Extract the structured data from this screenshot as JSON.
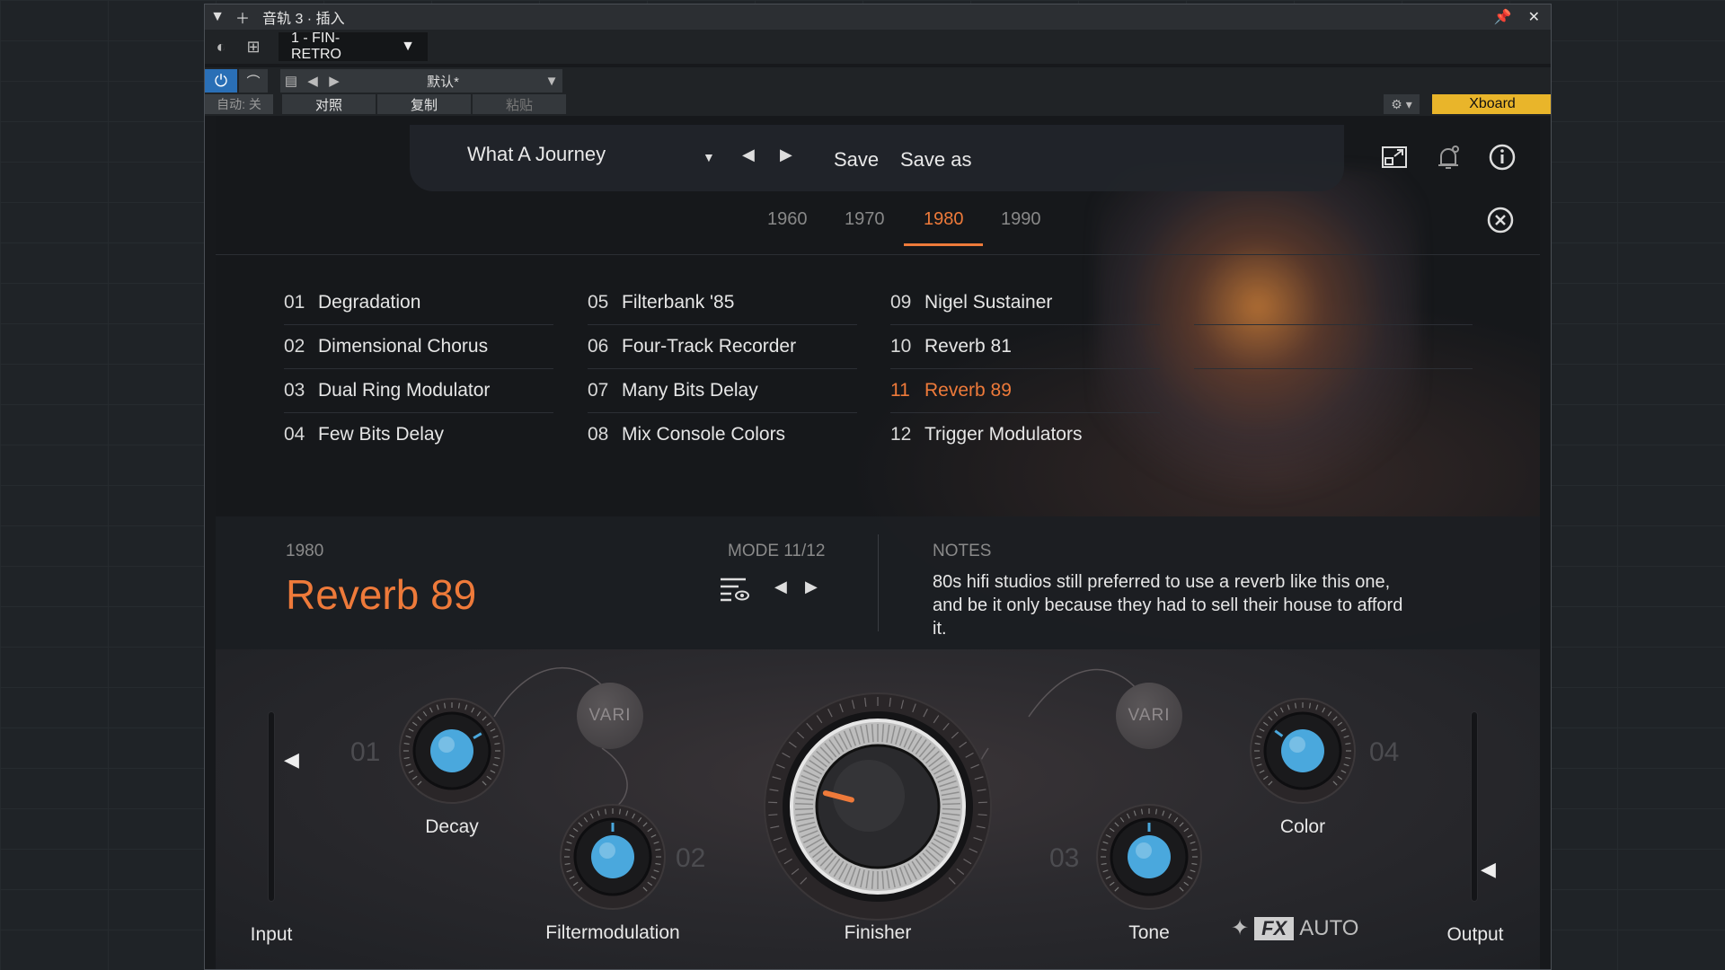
{
  "host": {
    "title": "音轨 3 · 插入",
    "device": "1 - FIN-RETRO",
    "preset": "默认*",
    "auto_label": "自动: 关",
    "compare_label": "对照",
    "copy_label": "复制",
    "paste_label": "粘贴",
    "xboard_label": "Xboard",
    "pin_icon": "pin-icon",
    "close_icon": "close-icon"
  },
  "plugin": {
    "preset_name": "What A Journey",
    "save_label": "Save",
    "save_as_label": "Save as",
    "years": [
      "1960",
      "1970",
      "1980",
      "1990"
    ],
    "active_year": "1980",
    "modes": [
      {
        "num": "01",
        "name": "Degradation"
      },
      {
        "num": "02",
        "name": "Dimensional Chorus"
      },
      {
        "num": "03",
        "name": "Dual Ring Modulator"
      },
      {
        "num": "04",
        "name": "Few Bits Delay"
      },
      {
        "num": "05",
        "name": "Filterbank '85"
      },
      {
        "num": "06",
        "name": "Four-Track Recorder"
      },
      {
        "num": "07",
        "name": "Many Bits Delay"
      },
      {
        "num": "08",
        "name": "Mix Console Colors"
      },
      {
        "num": "09",
        "name": "Nigel Sustainer"
      },
      {
        "num": "10",
        "name": "Reverb 81"
      },
      {
        "num": "11",
        "name": "Reverb 89"
      },
      {
        "num": "12",
        "name": "Trigger Modulators"
      }
    ],
    "active_mode": "11",
    "info": {
      "year": "1980",
      "name": "Reverb 89",
      "mode": "MODE 11/12",
      "notes_header": "NOTES",
      "notes": "80s hifi studios still preferred to use a reverb like this one, and be it only because they had to sell their house to afford it."
    },
    "controls": {
      "input_label": "Input",
      "output_label": "Output",
      "decay_label": "Decay",
      "decay_slot": "01",
      "filtermod_label": "Filtermodulation",
      "filtermod_slot": "02",
      "tone_label": "Tone",
      "tone_slot": "03",
      "color_label": "Color",
      "color_slot": "04",
      "finisher_label": "Finisher",
      "vari_label": "VARI",
      "fx_text": "FX",
      "auto_text": "AUTO"
    },
    "knob_values": {
      "decay": 0.72,
      "filtermod": 0.5,
      "tone": 0.5,
      "color": 0.3,
      "finisher": 0.22
    },
    "colors": {
      "accent": "#ee7a3a",
      "knob_blue": "#4aa8dd",
      "xboard": "#e9b52a",
      "power_blue": "#2a6fb6"
    }
  }
}
